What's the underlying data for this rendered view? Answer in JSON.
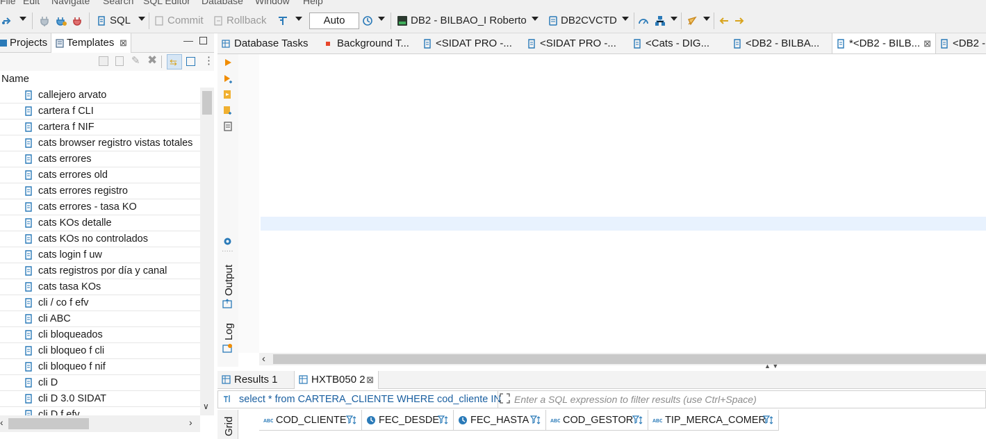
{
  "menubar": {
    "items": [
      "File",
      "Edit",
      "Navigate",
      "Search",
      "SQL Editor",
      "Database",
      "Window",
      "Help"
    ]
  },
  "toolbar": {
    "sql_label": "SQL",
    "commit_label": "Commit",
    "rollback_label": "Rollback",
    "transaction_mode": "Auto",
    "connection": "DB2 - BILBAO_I Roberto",
    "schema": "DB2CVCTD"
  },
  "left_panel": {
    "tabs": [
      "Projects",
      "Templates"
    ],
    "column_header": "Name",
    "templates": [
      "callejero arvato",
      "cartera f CLI",
      "cartera f NIF",
      "cats browser registro vistas totales",
      "cats errores",
      "cats errores old",
      "cats errores registro",
      "cats errores - tasa KO",
      "cats KOs detalle",
      "cats KOs no controlados",
      "cats login f uw",
      "cats registros por día y canal",
      "cats tasa KOs",
      "cli / co f efv",
      "cli ABC",
      "cli bloqueados",
      "cli bloqueo f cli",
      "cli bloqueo f nif",
      "cli D",
      "cli D 3.0 SIDAT",
      "cli D f efv"
    ]
  },
  "editor": {
    "tabs": [
      "Database Tasks",
      "Background T...",
      "<SIDAT PRO -...",
      "<SIDAT PRO -...",
      "<Cats - DIG...",
      "<DB2 - BILBA...",
      "*<DB2 - BILB...",
      "<DB2 -"
    ],
    "active_tab_index": 6,
    "side_views": [
      "Output",
      "Log"
    ]
  },
  "results": {
    "tabs": [
      "Results 1",
      "HXTB050 2"
    ],
    "active_tab_index": 1,
    "query": "select * from CARTERA_CLIENTE WHERE cod_cliente IN",
    "filter_placeholder": "Enter a SQL expression to filter results (use Ctrl+Space)",
    "side_label": "Grid",
    "columns": [
      "COD_CLIENTE",
      "FEC_DESDE",
      "FEC_HASTA",
      "COD_GESTOR",
      "TIP_MERCA_COMER"
    ]
  },
  "colors": {
    "accent": "#1a5fa0",
    "current_line": "#e8f2fe",
    "run_orange": "#f08c00"
  }
}
